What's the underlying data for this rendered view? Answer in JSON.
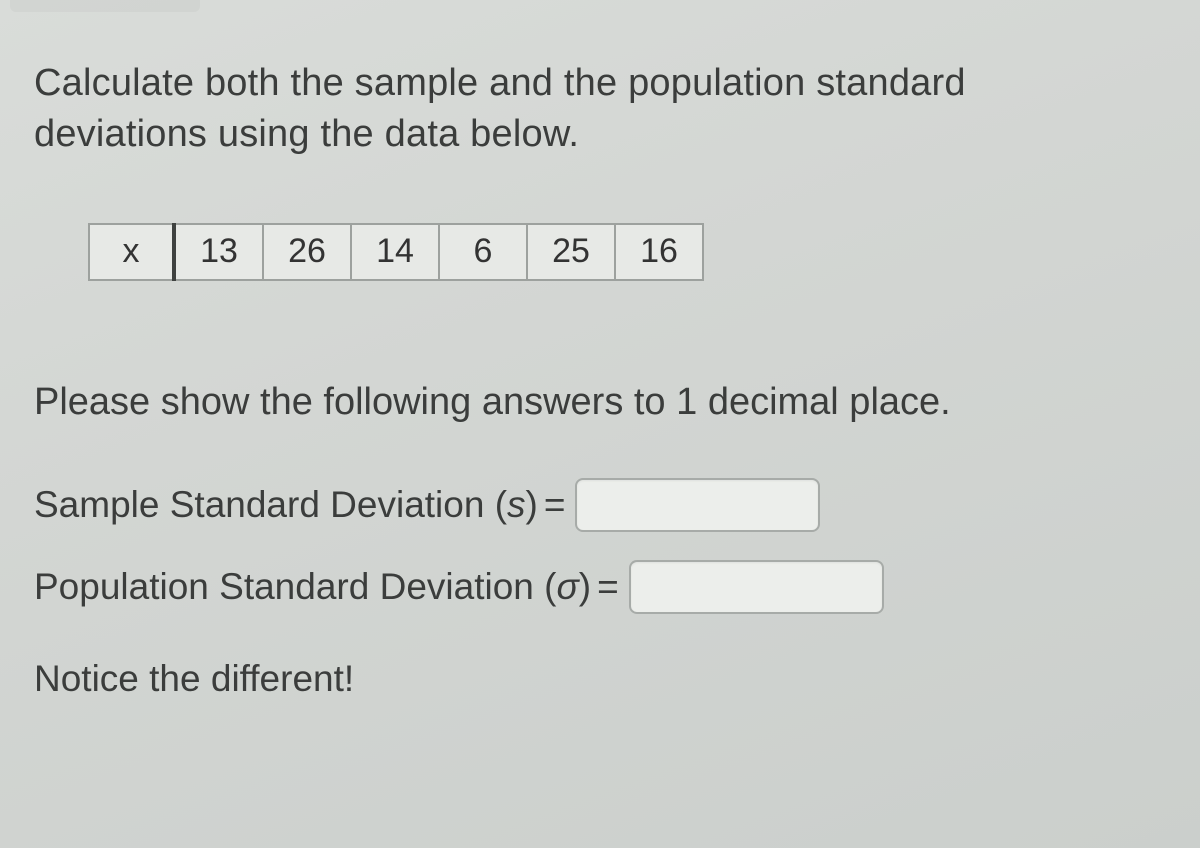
{
  "question": {
    "prompt": "Calculate both the sample and the population standard deviations using the data below.",
    "variable_label": "x",
    "values": [
      "13",
      "26",
      "14",
      "6",
      "25",
      "16"
    ],
    "instruction": "Please show the following answers to 1 decimal place.",
    "answers": {
      "sample_label_pre": "Sample Standard Deviation (",
      "sample_symbol": "s",
      "sample_label_post": ") ",
      "population_label_pre": "Population Standard Deviation (",
      "population_symbol": "σ",
      "population_label_post": ") ",
      "equals": "="
    },
    "notice": "Notice the different!"
  }
}
